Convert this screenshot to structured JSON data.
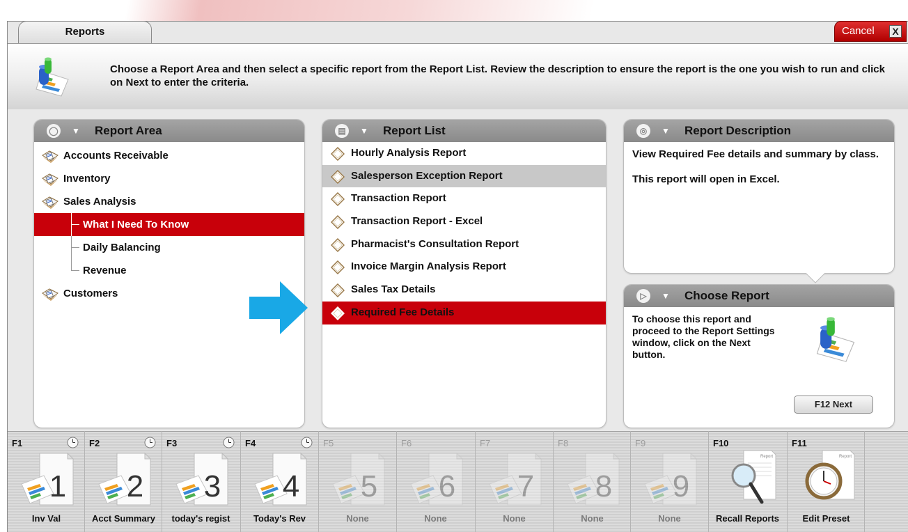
{
  "window": {
    "tab_title": "Reports",
    "cancel_label": "Cancel",
    "close_glyph": "X",
    "instructions": "Choose a Report Area and then select a specific report from the Report List. Review the description to ensure the report is the one you wish to run and click on Next to enter the criteria."
  },
  "report_area": {
    "title": "Report Area",
    "items": [
      {
        "label": "Accounts Receivable",
        "level": 0
      },
      {
        "label": "Inventory",
        "level": 0
      },
      {
        "label": "Sales Analysis",
        "level": 0
      },
      {
        "label": "What I Need To Know",
        "level": 1,
        "selected": true
      },
      {
        "label": "Daily Balancing",
        "level": 1
      },
      {
        "label": "Revenue",
        "level": 1
      },
      {
        "label": "Customers",
        "level": 0
      }
    ]
  },
  "report_list": {
    "title": "Report List",
    "items": [
      {
        "label": "Hourly Analysis Report"
      },
      {
        "label": "Salesperson Exception Report",
        "hover": true
      },
      {
        "label": "Transaction Report"
      },
      {
        "label": "Transaction Report - Excel"
      },
      {
        "label": "Pharmacist's Consultation Report"
      },
      {
        "label": "Invoice Margin Analysis Report"
      },
      {
        "label": "Sales Tax Details"
      },
      {
        "label": "Required Fee Details",
        "selected": true
      }
    ]
  },
  "report_description": {
    "title": "Report Description",
    "line1": "View Required Fee details and summary by class.",
    "line2": "This report will open in Excel."
  },
  "choose_report": {
    "title": "Choose Report",
    "text": "To choose this report and proceed to the Report Settings window, click on the Next button.",
    "next_label": "F12 Next"
  },
  "fkeys": [
    {
      "code": "F1",
      "label": "Inv Val",
      "number": "1",
      "enabled": true,
      "clock": true
    },
    {
      "code": "F2",
      "label": "Acct Summary",
      "number": "2",
      "enabled": true,
      "clock": true
    },
    {
      "code": "F3",
      "label": "today's regist",
      "number": "3",
      "enabled": true,
      "clock": true
    },
    {
      "code": "F4",
      "label": "Today's Rev",
      "number": "4",
      "enabled": true,
      "clock": true
    },
    {
      "code": "F5",
      "label": "None",
      "number": "5",
      "enabled": false
    },
    {
      "code": "F6",
      "label": "None",
      "number": "6",
      "enabled": false
    },
    {
      "code": "F7",
      "label": "None",
      "number": "7",
      "enabled": false
    },
    {
      "code": "F8",
      "label": "None",
      "number": "8",
      "enabled": false
    },
    {
      "code": "F9",
      "label": "None",
      "number": "9",
      "enabled": false
    },
    {
      "code": "F10",
      "label": "Recall Reports",
      "enabled": true,
      "doc_text": "Report"
    },
    {
      "code": "F11",
      "label": "Edit Preset",
      "enabled": true,
      "doc_text": "Report"
    }
  ],
  "colors": {
    "accent_red": "#c8000a",
    "arrow_blue": "#19a8e6",
    "panel_header": "#9a9a9a"
  }
}
